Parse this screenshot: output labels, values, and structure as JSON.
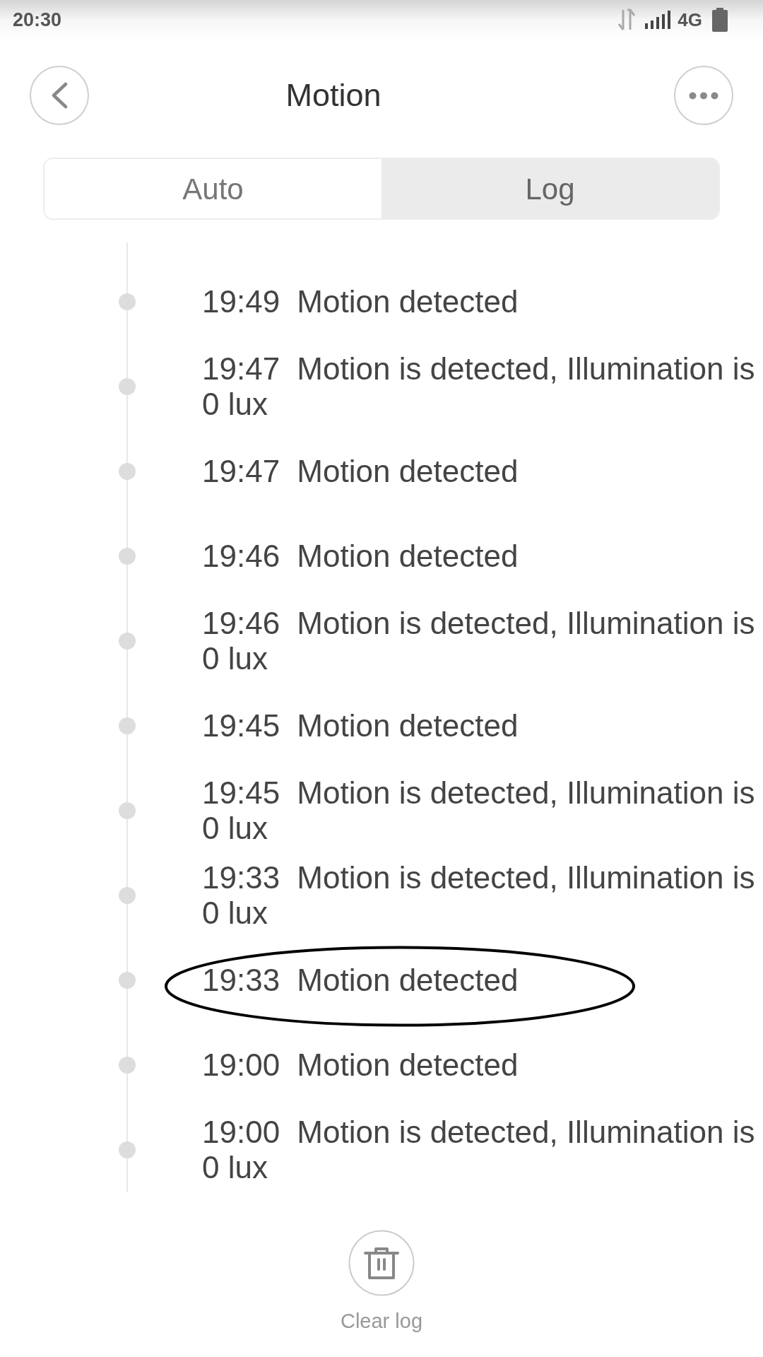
{
  "status_bar": {
    "time": "20:30",
    "network": "4G"
  },
  "header": {
    "title": "Motion"
  },
  "tabs": [
    {
      "label": "Auto",
      "selected": false
    },
    {
      "label": "Log",
      "selected": true
    }
  ],
  "log": [
    {
      "time": "19:49",
      "message": "Motion detected",
      "circled": false
    },
    {
      "time": "19:47",
      "message": "Motion is detected, Illumination is 0 lux",
      "circled": false
    },
    {
      "time": "19:47",
      "message": "Motion detected",
      "circled": false
    },
    {
      "time": "19:46",
      "message": "Motion detected",
      "circled": false
    },
    {
      "time": "19:46",
      "message": "Motion is detected, Illumination is 0 lux",
      "circled": false
    },
    {
      "time": "19:45",
      "message": "Motion detected",
      "circled": false
    },
    {
      "time": "19:45",
      "message": "Motion is detected, Illumination is 0 lux",
      "circled": false
    },
    {
      "time": "19:33",
      "message": "Motion is detected, Illumination is 0 lux",
      "circled": false
    },
    {
      "time": "19:33",
      "message": "Motion detected",
      "circled": true
    },
    {
      "time": "19:00",
      "message": "Motion detected",
      "circled": false
    },
    {
      "time": "19:00",
      "message": "Motion is detected, Illumination is 0 lux",
      "circled": false
    }
  ],
  "clear_button": {
    "label": "Clear log"
  }
}
